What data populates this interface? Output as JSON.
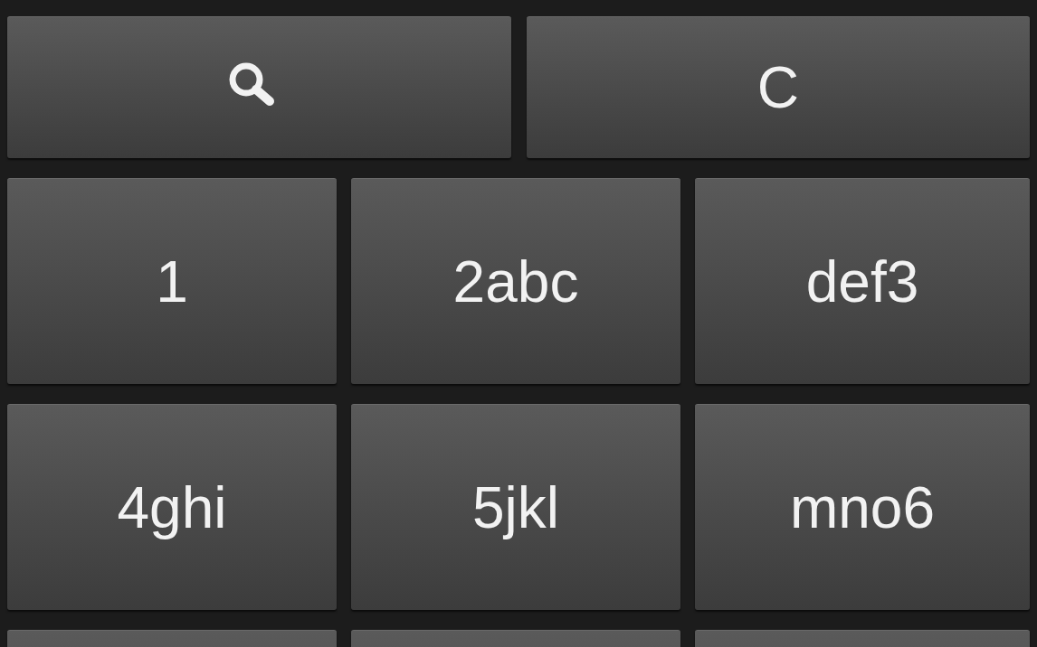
{
  "top_row": [
    {
      "kind": "search"
    },
    {
      "kind": "text",
      "label": "C"
    }
  ],
  "key_rows": [
    [
      {
        "label": "1"
      },
      {
        "label": "2abc"
      },
      {
        "label": "def3"
      }
    ],
    [
      {
        "label": "4ghi"
      },
      {
        "label": "5jkl"
      },
      {
        "label": "mno6"
      }
    ]
  ],
  "partial_row": [
    {
      "kind": "key"
    },
    {
      "kind": "key"
    },
    {
      "kind": "key"
    }
  ]
}
